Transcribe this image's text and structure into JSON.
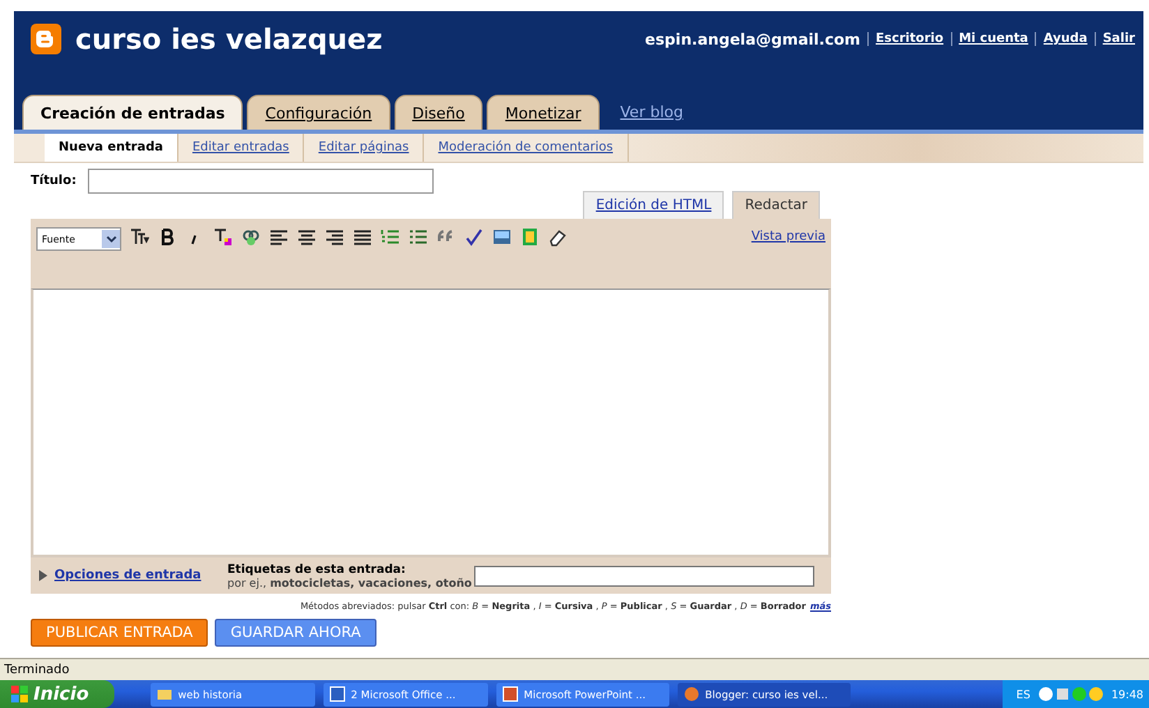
{
  "header": {
    "blog_title": "curso ies velazquez",
    "account": "espin.angela@gmail.com",
    "links": [
      "Escritorio",
      "Mi cuenta",
      "Ayuda",
      "Salir"
    ]
  },
  "tabs": [
    {
      "label": "Creación de entradas",
      "selected": true
    },
    {
      "label": "Configuración",
      "selected": false
    },
    {
      "label": "Diseño",
      "selected": false
    },
    {
      "label": "Monetizar",
      "selected": false
    }
  ],
  "view_blog": "Ver blog",
  "subtabs": [
    {
      "label": "Nueva entrada",
      "selected": true
    },
    {
      "label": "Editar entradas",
      "selected": false
    },
    {
      "label": "Editar páginas",
      "selected": false
    },
    {
      "label": "Moderación de comentarios",
      "selected": false
    }
  ],
  "title_field": {
    "label": "Título:"
  },
  "editor_tabs": [
    {
      "label": "Edición de HTML",
      "selected": false
    },
    {
      "label": "Redactar",
      "selected": true
    }
  ],
  "toolbar": {
    "font": "Fuente",
    "preview": "Vista previa"
  },
  "footer": {
    "options": "Opciones de entrada",
    "labels_title": "Etiquetas de esta entrada:",
    "labels_hint": "por ej., **motocicletas, vacaciones, otoño**"
  },
  "shortcuts": {
    "text": "Métodos abreviados: pulsar **Ctrl** con: *B* = **Negrita** , *I* = **Cursiva** , *P* = **Publicar** , *S* = **Guardar** , *D* = **Borrador**",
    "more": "más"
  },
  "buttons": [
    {
      "label": "PUBLICAR ENTRADA",
      "kind": "publish"
    },
    {
      "label": "GUARDAR AHORA",
      "kind": "save"
    }
  ],
  "status_bar": "Terminado",
  "taskbar": {
    "start": "Inicio",
    "items": [
      {
        "label": "web historia",
        "kind": "folder",
        "selected": false
      },
      {
        "label": "2 Microsoft Office ...",
        "kind": "word",
        "selected": false
      },
      {
        "label": "Microsoft PowerPoint ...",
        "kind": "powerpoint",
        "selected": false
      },
      {
        "label": "Blogger: curso ies vel...",
        "kind": "browser",
        "selected": true
      }
    ],
    "language": "ES",
    "clock": "19:48"
  }
}
